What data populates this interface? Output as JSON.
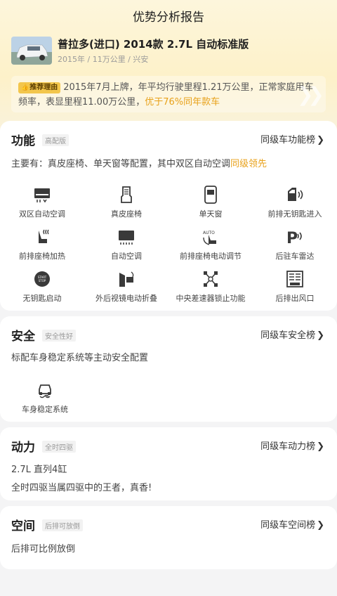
{
  "page": {
    "title": "优势分析报告"
  },
  "car": {
    "name": "普拉多(进口) 2014款 2.7L 自动标准版",
    "meta": "2015年 / 11万公里 / 兴安"
  },
  "reason": {
    "badge": "推荐理由",
    "text": "2015年7月上牌，年平均行驶里程1.21万公里，正常家庭用车频率，表显里程11.00万公里，",
    "highlight": "优于76%同年款车"
  },
  "function_section": {
    "title": "功能",
    "tag": "高配版",
    "link": "同级车功能榜",
    "desc": "主要有：真皮座椅、单天窗等配置，其中双区自动空调",
    "desc_highlight": "同级领先",
    "features": [
      {
        "label": "双区自动空调",
        "icon": "dual-zone-ac-icon"
      },
      {
        "label": "真皮座椅",
        "icon": "leather-seat-icon"
      },
      {
        "label": "单天窗",
        "icon": "sunroof-icon"
      },
      {
        "label": "前排无钥匙进入",
        "icon": "keyless-entry-icon"
      },
      {
        "label": "前排座椅加热",
        "icon": "seat-heating-icon"
      },
      {
        "label": "自动空调",
        "icon": "auto-ac-icon"
      },
      {
        "label": "前排座椅电动调节",
        "icon": "power-seat-icon"
      },
      {
        "label": "后驻车雷达",
        "icon": "parking-radar-icon"
      },
      {
        "label": "无钥匙启动",
        "icon": "start-stop-button-icon"
      },
      {
        "label": "外后视镜电动折叠",
        "icon": "folding-mirror-icon"
      },
      {
        "label": "中央差速器锁止功能",
        "icon": "diff-lock-icon"
      },
      {
        "label": "后排出风口",
        "icon": "rear-vent-icon"
      }
    ]
  },
  "safety_section": {
    "title": "安全",
    "tag": "安全性好",
    "link": "同级车安全榜",
    "desc": "标配车身稳定系统等主动安全配置",
    "features": [
      {
        "label": "车身稳定系统",
        "icon": "stability-control-icon"
      }
    ]
  },
  "power_section": {
    "title": "动力",
    "tag": "全时四驱",
    "link": "同级车动力榜",
    "line1": "2.7L 直列4缸",
    "line2": "全时四驱当属四驱中的王者，真香!"
  },
  "space_section": {
    "title": "空间",
    "tag": "后排可放倒",
    "link": "同级车空间榜",
    "desc": "后排可比例放倒"
  },
  "colors": {
    "accent": "#e8a11a",
    "badge": "#f3c64c",
    "icon": "#3a3a3a"
  }
}
